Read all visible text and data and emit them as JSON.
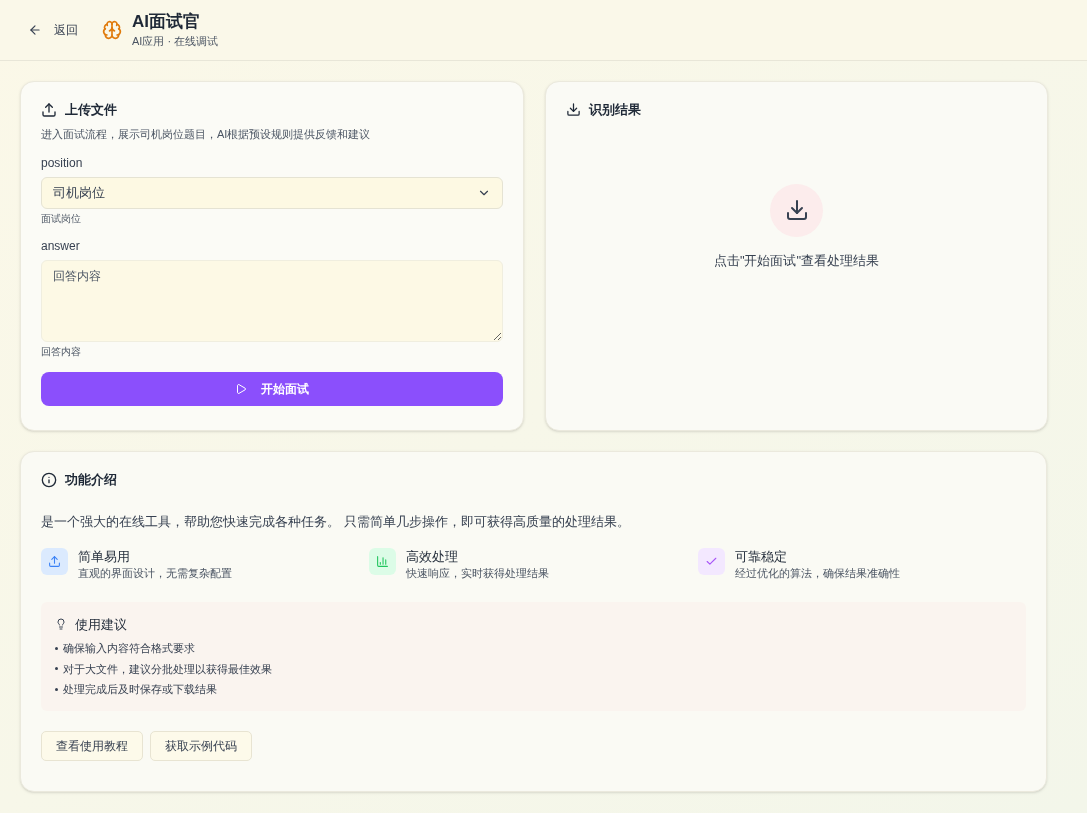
{
  "header": {
    "back": "返回",
    "title": "AI面试官",
    "subtitle": "AI应用 · 在线调试"
  },
  "upload_card": {
    "title": "上传文件",
    "description": "进入面试流程，展示司机岗位题目，AI根据预设规则提供反馈和建议",
    "fields": [
      {
        "kind": "select",
        "label": "position",
        "value": "司机岗位",
        "hint": "面试岗位"
      },
      {
        "kind": "textarea",
        "label": "answer",
        "placeholder": "回答内容",
        "hint": "回答内容"
      }
    ],
    "submit": "开始面试"
  },
  "result_card": {
    "title": "识别结果",
    "empty_text": "点击\"开始面试\"查看处理结果"
  },
  "intro_card": {
    "title": "功能介绍",
    "summary": "是一个强大的在线工具，帮助您快速完成各种任务。 只需简单几步操作，即可获得高质量的处理结果。",
    "features": [
      {
        "kind": "upload",
        "title": "简单易用",
        "description": "直观的界面设计，无需复杂配置"
      },
      {
        "kind": "chart",
        "title": "高效处理",
        "description": "快速响应，实时获得处理结果"
      },
      {
        "kind": "check",
        "title": "可靠稳定",
        "description": "经过优化的算法，确保结果准确性"
      }
    ],
    "tips": {
      "title": "使用建议",
      "items": [
        "确保输入内容符合格式要求",
        "对于大文件，建议分批处理以获得最佳效果",
        "处理完成后及时保存或下载结果"
      ]
    },
    "buttons": [
      "查看使用教程",
      "获取示例代码"
    ]
  }
}
